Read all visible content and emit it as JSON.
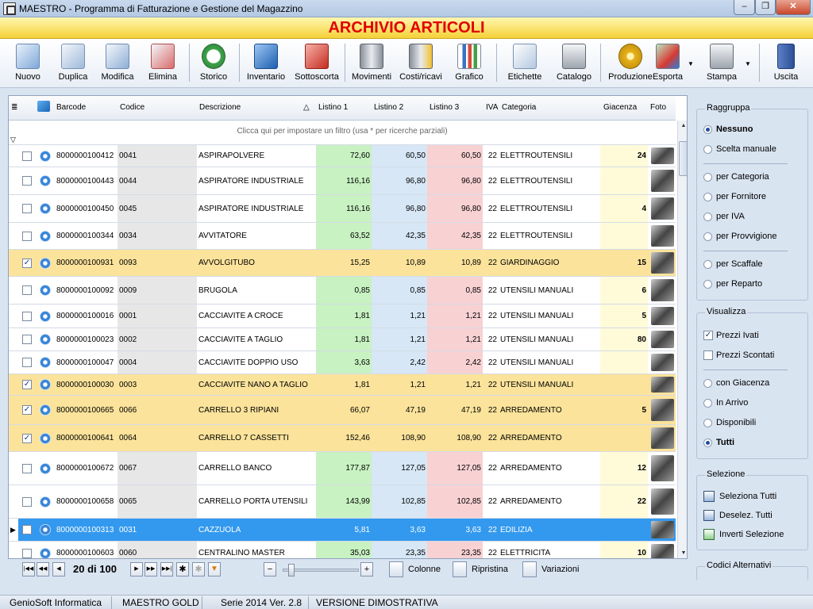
{
  "window": {
    "title": "MAESTRO - Programma di Fatturazione e Gestione del Magazzino",
    "minimize": "–",
    "maximize": "❐",
    "close": "✕"
  },
  "banner": {
    "title": "ARCHIVIO ARTICOLI"
  },
  "toolbar": {
    "nuovo": "Nuovo",
    "duplica": "Duplica",
    "modifica": "Modifica",
    "elimina": "Elimina",
    "storico": "Storico",
    "inventario": "Inventario",
    "sottoscorta": "Sottoscorta",
    "movimenti": "Movimenti",
    "costi_ricavi": "Costi/ricavi",
    "grafico": "Grafico",
    "etichette": "Etichette",
    "catalogo": "Catalogo",
    "produzione": "Produzione",
    "esporta": "Esporta",
    "stampa": "Stampa",
    "uscita": "Uscita"
  },
  "grid": {
    "columns": {
      "barcode": "Barcode",
      "codice": "Codice",
      "descrizione": "Descrizione",
      "sort_indicator": "△",
      "listino1": "Listino 1",
      "listino2": "Listino 2",
      "listino3": "Listino 3",
      "iva": "IVA",
      "categoria": "Categoria",
      "giacenza": "Giacenza",
      "foto": "Foto"
    },
    "filter_hint": "Clicca qui per impostare un filtro (usa * per ricerche parziali)",
    "rows": [
      {
        "checked": false,
        "barcode": "8000000100412",
        "codice": "0041",
        "descrizione": "ASPIRAPOLVERE",
        "l1": "72,60",
        "l2": "60,50",
        "l3": "60,50",
        "iva": "22",
        "categoria": "ELETTROUTENSILI",
        "giacenza": "24",
        "state": "normal"
      },
      {
        "checked": false,
        "barcode": "8000000100443",
        "codice": "0044",
        "descrizione": "ASPIRATORE INDUSTRIALE",
        "l1": "116,16",
        "l2": "96,80",
        "l3": "96,80",
        "iva": "22",
        "categoria": "ELETTROUTENSILI",
        "giacenza": "",
        "state": "normal"
      },
      {
        "checked": false,
        "barcode": "8000000100450",
        "codice": "0045",
        "descrizione": "ASPIRATORE INDUSTRIALE",
        "l1": "116,16",
        "l2": "96,80",
        "l3": "96,80",
        "iva": "22",
        "categoria": "ELETTROUTENSILI",
        "giacenza": "4",
        "state": "normal"
      },
      {
        "checked": false,
        "barcode": "8000000100344",
        "codice": "0034",
        "descrizione": "AVVITATORE",
        "l1": "63,52",
        "l2": "42,35",
        "l3": "42,35",
        "iva": "22",
        "categoria": "ELETTROUTENSILI",
        "giacenza": "",
        "state": "normal"
      },
      {
        "checked": true,
        "barcode": "8000000100931",
        "codice": "0093",
        "descrizione": "AVVOLGITUBO",
        "l1": "15,25",
        "l2": "10,89",
        "l3": "10,89",
        "iva": "22",
        "categoria": "GIARDINAGGIO",
        "giacenza": "15",
        "state": "sel"
      },
      {
        "checked": false,
        "barcode": "8000000100092",
        "codice": "0009",
        "descrizione": "BRUGOLA",
        "l1": "0,85",
        "l2": "0,85",
        "l3": "0,85",
        "iva": "22",
        "categoria": "UTENSILI MANUALI",
        "giacenza": "6",
        "state": "normal"
      },
      {
        "checked": false,
        "barcode": "8000000100016",
        "codice": "0001",
        "descrizione": "CACCIAVITE A CROCE",
        "l1": "1,81",
        "l2": "1,21",
        "l3": "1,21",
        "iva": "22",
        "categoria": "UTENSILI MANUALI",
        "giacenza": "5",
        "state": "normal"
      },
      {
        "checked": false,
        "barcode": "8000000100023",
        "codice": "0002",
        "descrizione": "CACCIAVITE A TAGLIO",
        "l1": "1,81",
        "l2": "1,21",
        "l3": "1,21",
        "iva": "22",
        "categoria": "UTENSILI MANUALI",
        "giacenza": "80",
        "state": "normal"
      },
      {
        "checked": false,
        "barcode": "8000000100047",
        "codice": "0004",
        "descrizione": "CACCIAVITE DOPPIO USO",
        "l1": "3,63",
        "l2": "2,42",
        "l3": "2,42",
        "iva": "22",
        "categoria": "UTENSILI MANUALI",
        "giacenza": "",
        "state": "normal"
      },
      {
        "checked": true,
        "barcode": "8000000100030",
        "codice": "0003",
        "descrizione": "CACCIAVITE NANO A TAGLIO",
        "l1": "1,81",
        "l2": "1,21",
        "l3": "1,21",
        "iva": "22",
        "categoria": "UTENSILI MANUALI",
        "giacenza": "",
        "state": "sel"
      },
      {
        "checked": true,
        "barcode": "8000000100665",
        "codice": "0066",
        "descrizione": "CARRELLO 3 RIPIANI",
        "l1": "66,07",
        "l2": "47,19",
        "l3": "47,19",
        "iva": "22",
        "categoria": "ARREDAMENTO",
        "giacenza": "5",
        "state": "sel"
      },
      {
        "checked": true,
        "barcode": "8000000100641",
        "codice": "0064",
        "descrizione": "CARRELLO 7 CASSETTI",
        "l1": "152,46",
        "l2": "108,90",
        "l3": "108,90",
        "iva": "22",
        "categoria": "ARREDAMENTO",
        "giacenza": "",
        "state": "sel"
      },
      {
        "checked": false,
        "barcode": "8000000100672",
        "codice": "0067",
        "descrizione": "CARRELLO BANCO",
        "l1": "177,87",
        "l2": "127,05",
        "l3": "127,05",
        "iva": "22",
        "categoria": "ARREDAMENTO",
        "giacenza": "12",
        "state": "normal"
      },
      {
        "checked": false,
        "barcode": "8000000100658",
        "codice": "0065",
        "descrizione": "CARRELLO PORTA UTENSILI",
        "l1": "143,99",
        "l2": "102,85",
        "l3": "102,85",
        "iva": "22",
        "categoria": "ARREDAMENTO",
        "giacenza": "22",
        "state": "normal"
      },
      {
        "checked": false,
        "barcode": "8000000100313",
        "codice": "0031",
        "descrizione": "CAZZUOLA",
        "l1": "5,81",
        "l2": "3,63",
        "l3": "3,63",
        "iva": "22",
        "categoria": "EDILIZIA",
        "giacenza": "",
        "state": "cur"
      },
      {
        "checked": false,
        "barcode": "8000000100603",
        "codice": "0060",
        "descrizione": "CENTRALINO MASTER",
        "l1": "35,03",
        "l2": "23,35",
        "l3": "23,35",
        "iva": "22",
        "categoria": "ELETTRICITA",
        "giacenza": "10",
        "state": "normal"
      }
    ]
  },
  "navigator": {
    "first": "|◀◀",
    "prev_page": "◀◀",
    "prev": "◀",
    "next": "▶",
    "next_page": "▶▶",
    "last": "▶▶|",
    "position": "20 di 100",
    "zoom_minus": "−",
    "zoom_plus": "+",
    "colonne": "Colonne",
    "ripristina": "Ripristina",
    "variazioni": "Variazioni"
  },
  "panel": {
    "raggruppa": {
      "caption": "Raggruppa",
      "nessuno": "Nessuno",
      "scelta_manuale": "Scelta manuale",
      "per_categoria": "per Categoria",
      "per_fornitore": "per Fornitore",
      "per_iva": "per IVA",
      "per_provvigione": "per Provvigione",
      "per_scaffale": "per Scaffale",
      "per_reparto": "per Reparto"
    },
    "visualizza": {
      "caption": "Visualizza",
      "prezzi_ivati": "Prezzi Ivati",
      "prezzi_scontati": "Prezzi Scontati",
      "con_giacenza": "con Giacenza",
      "in_arrivo": "In Arrivo",
      "disponibili": "Disponibili",
      "tutti": "Tutti"
    },
    "selezione": {
      "caption": "Selezione",
      "seleziona_tutti": "Seleziona Tutti",
      "deselez_tutti": "Deselez. Tutti",
      "inverti": "Inverti Selezione"
    },
    "codici": {
      "caption": "Codici Alternativi"
    }
  },
  "status": {
    "company": "GenioSoft Informatica",
    "edition": "MAESTRO GOLD",
    "version": "Serie 2014 Ver. 2.8",
    "mode": "VERSIONE DIMOSTRATIVA"
  }
}
